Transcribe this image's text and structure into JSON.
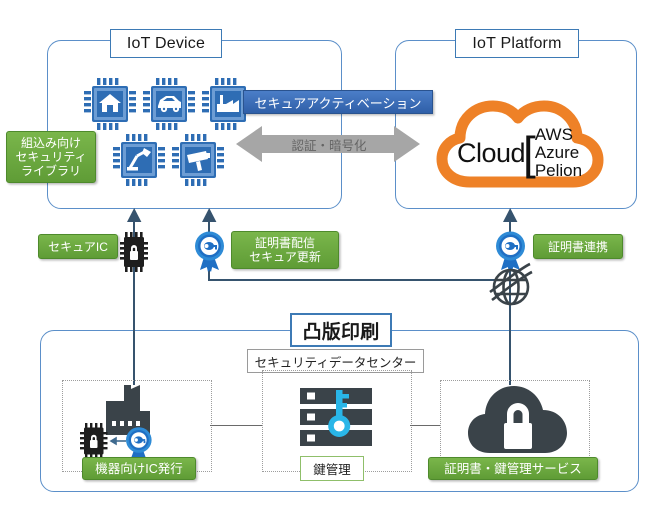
{
  "diagram": {
    "title_top_left": "IoT Device",
    "title_top_right": "IoT Platform",
    "title_bottom": "凸版印刷"
  },
  "iot_device": {
    "chips": [
      {
        "name": "house-chip",
        "icon": "house-icon"
      },
      {
        "name": "car-chip",
        "icon": "car-icon"
      },
      {
        "name": "factory-chip",
        "icon": "factory-icon"
      },
      {
        "name": "robot-arm-chip",
        "icon": "robot-arm-icon"
      },
      {
        "name": "security-camera-chip",
        "icon": "security-camera-icon"
      }
    ],
    "library_label": [
      "組込み向け",
      "セキュリティ",
      "ライブラリ"
    ]
  },
  "middle": {
    "banner": "セキュアアクティベーション",
    "arrow_label": "認証・暗号化"
  },
  "iot_platform": {
    "cloud_word": "Cloud",
    "bracket": "[",
    "brands": [
      "AWS",
      "Azure",
      "Pelion"
    ]
  },
  "connectors": {
    "secure_ic": "セキュアIC",
    "cert_delivery": [
      "証明書配信",
      "セキュア更新"
    ],
    "cert_linkage": "証明書連携"
  },
  "toppan": {
    "data_center": "セキュリティデータセンター",
    "cards": [
      {
        "label": "機器向けIC発行",
        "style": "green",
        "icon": "factory-lock-certificate-icon"
      },
      {
        "label": "鍵管理",
        "style": "white",
        "icon": "server-key-icon"
      },
      {
        "label": "証明書・鍵管理サービス",
        "style": "green",
        "icon": "cloud-lock-icon"
      }
    ]
  },
  "colors": {
    "panel_border": "#5b8fc9",
    "green": "#6aab45",
    "blue_banner": "#3b6db5",
    "orange_cloud": "#ee8127",
    "gray_arrow": "#a6a6a6",
    "line": "#36536e",
    "chip_blue": "#2e6db4",
    "dark_icon": "#3a4349",
    "key_cyan": "#29b6e8"
  }
}
